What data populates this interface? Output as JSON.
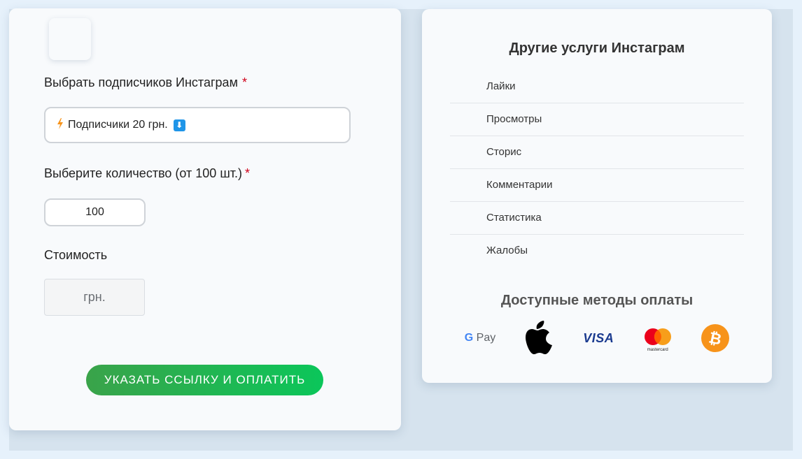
{
  "form": {
    "followers_label": "Выбрать подписчиков Инстаграм",
    "required_mark": "*",
    "selected_option": "Подписчики 20 грн.",
    "quantity_label": "Выберите количество (от 100 шт.)",
    "quantity_value": "100",
    "price_label": "Стоимость",
    "price_value": "грн.",
    "submit_label": "УКАЗАТЬ ССЫЛКУ И ОПЛАТИТЬ"
  },
  "sidebar": {
    "title": "Другие услуги Инстаграм",
    "services": [
      "Лайки",
      "Просмотры",
      "Сторис",
      "Комментарии",
      "Статистика",
      "Жалобы"
    ],
    "payments_title": "Доступные методы оплаты",
    "payments": {
      "gpay": "Pay",
      "gpay_g": "G",
      "visa": "VISA",
      "mastercard": "mastercard"
    }
  },
  "colors": {
    "button_start": "#3aa34a",
    "button_end": "#0bc65a",
    "required": "#d0021b",
    "bitcoin": "#f7931a"
  },
  "icons": [
    "logo-placeholder",
    "bolt-icon",
    "down-arrow-icon",
    "gpay-logo",
    "apple-logo",
    "visa-logo",
    "mastercard-logo",
    "bitcoin-logo"
  ]
}
